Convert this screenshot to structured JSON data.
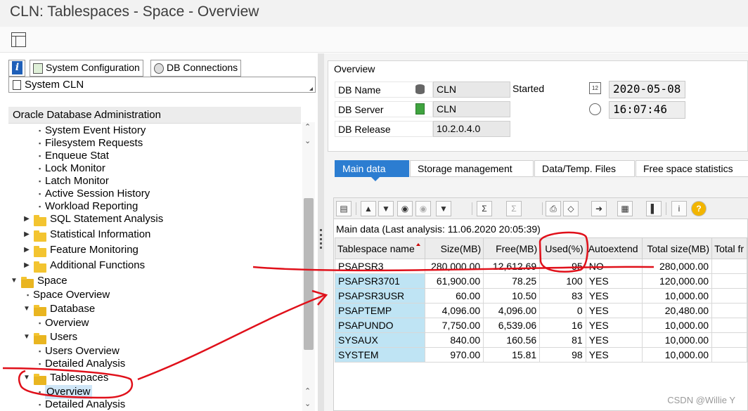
{
  "window": {
    "title": "CLN: Tablespaces - Space - Overview"
  },
  "left_toolbar": {
    "info_glyph": "i",
    "system_configuration": "System Configuration",
    "db_connections": "DB Connections",
    "system_selector": "System CLN"
  },
  "tree": {
    "header": "Oracle Database Administration",
    "items": [
      {
        "label": "System Event History"
      },
      {
        "label": "Filesystem Requests"
      },
      {
        "label": "Enqueue Stat"
      },
      {
        "label": "Lock Monitor"
      },
      {
        "label": "Latch Monitor"
      },
      {
        "label": "Active Session History"
      },
      {
        "label": "Workload Reporting"
      },
      {
        "label": "SQL Statement Analysis"
      },
      {
        "label": "Statistical Information"
      },
      {
        "label": "Feature Monitoring"
      },
      {
        "label": "Additional Functions"
      },
      {
        "label": "Space"
      },
      {
        "label": "Space Overview"
      },
      {
        "label": "Database"
      },
      {
        "label": "Overview"
      },
      {
        "label": "Users"
      },
      {
        "label": "Users Overview"
      },
      {
        "label": "Detailed Analysis"
      },
      {
        "label": "Tablespaces"
      },
      {
        "label": "Overview"
      },
      {
        "label": "Detailed Analysis"
      }
    ]
  },
  "overview": {
    "title": "Overview",
    "db_name_label": "DB Name",
    "db_name_value": "CLN",
    "db_server_label": "DB Server",
    "db_server_value": "CLN",
    "db_release_label": "DB Release",
    "db_release_value": "10.2.0.4.0",
    "started_label": "Started",
    "started_date": "2020-05-08",
    "started_time": "16:07:46",
    "calendar_icon_text": "12"
  },
  "tabs": [
    {
      "label": "Main data"
    },
    {
      "label": "Storage management"
    },
    {
      "label": "Data/Temp. Files"
    },
    {
      "label": "Free space statistics"
    }
  ],
  "grid": {
    "title": "Main data   (Last analysis: 11.06.2020 20:05:39)",
    "columns": [
      "Tablespace name",
      "Size(MB)",
      "Free(MB)",
      "Used(%)",
      "Autoextend",
      "Total size(MB)",
      "Total fr"
    ],
    "rows": [
      [
        "PSAPSR3",
        "280,000.00",
        "12,612.69",
        "95",
        "NO",
        "280,000.00",
        ""
      ],
      [
        "PSAPSR3701",
        "61,900.00",
        "78.25",
        "100",
        "YES",
        "120,000.00",
        ""
      ],
      [
        "PSAPSR3USR",
        "60.00",
        "10.50",
        "83",
        "YES",
        "10,000.00",
        ""
      ],
      [
        "PSAPTEMP",
        "4,096.00",
        "4,096.00",
        "0",
        "YES",
        "20,480.00",
        ""
      ],
      [
        "PSAPUNDO",
        "7,750.00",
        "6,539.06",
        "16",
        "YES",
        "10,000.00",
        ""
      ],
      [
        "SYSAUX",
        "840.00",
        "160.56",
        "81",
        "YES",
        "10,000.00",
        ""
      ],
      [
        "SYSTEM",
        "970.00",
        "15.81",
        "98",
        "YES",
        "10,000.00",
        ""
      ]
    ]
  },
  "watermark": "CSDN @Willie  Y",
  "colors": {
    "accent": "#2c7dd1",
    "key_cell": "#bfe4f4",
    "annotation": "#e0101a",
    "folder": "#f3c430"
  }
}
